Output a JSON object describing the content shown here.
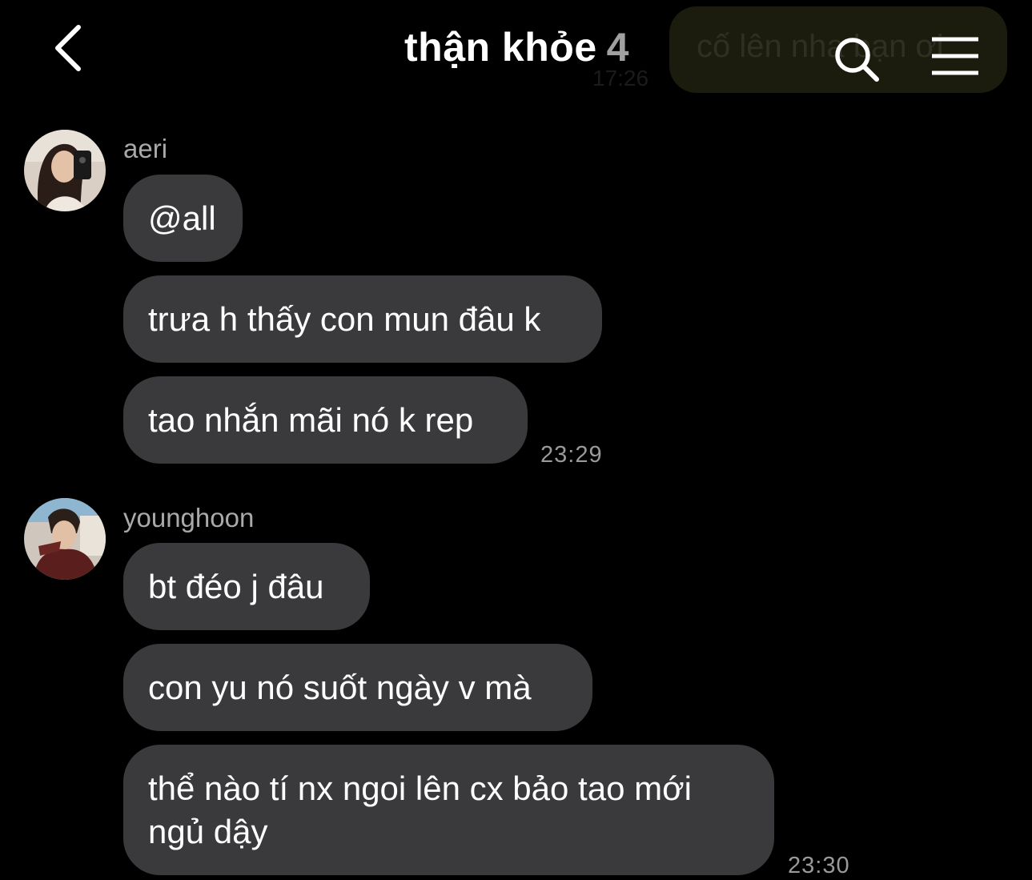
{
  "header": {
    "title": "thận khỏe",
    "member_count": "4",
    "ghost_message": "cố lên nha bạn ơi",
    "ghost_time": "17:26"
  },
  "messages": [
    {
      "sender": "aeri",
      "bubbles": [
        "@all",
        "trưa h thấy con mun đâu k",
        "tao nhắn mãi nó k rep"
      ],
      "time": "23:29"
    },
    {
      "sender": "younghoon",
      "bubbles": [
        "bt đéo j đâu",
        "con yu nó suốt ngày v mà",
        "thể nào tí nx ngoi lên cx bảo tao mới ngủ dậy"
      ],
      "time": "23:30"
    }
  ],
  "colors": {
    "background": "#000000",
    "bubble": "#3a3a3c",
    "secondary_text": "#a9a9a9"
  },
  "icons": [
    "back-chevron-icon",
    "search-icon",
    "menu-icon"
  ]
}
